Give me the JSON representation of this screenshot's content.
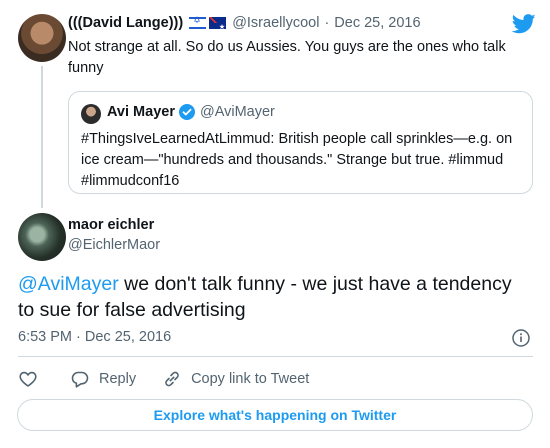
{
  "parent_tweet": {
    "name": "(((David Lange)))",
    "flags": [
      "israel-flag-icon",
      "australia-flag-icon"
    ],
    "handle": "@Israellycool",
    "separator": "·",
    "date": "Dec 25, 2016",
    "text": "Not strange at all. So do us Aussies. You guys are the ones who talk funny"
  },
  "quoted_tweet": {
    "name": "Avi Mayer",
    "verified": true,
    "handle": "@AviMayer",
    "text": "#ThingsIveLearnedAtLimmud: British people call sprinkles—e.g. on ice cream—\"hundreds and thousands.\" Strange but true. #limmud #limmudconf16"
  },
  "main_tweet": {
    "name": "maor eichler",
    "handle": "@EichlerMaor",
    "mention": "@AviMayer",
    "text": " we don't talk funny - we just have a tendency to sue for false advertising",
    "timestamp": "6:53 PM · Dec 25, 2016"
  },
  "actions": {
    "reply_label": "Reply",
    "copy_label": "Copy link to Tweet"
  },
  "explore_button": "Explore what's happening on Twitter",
  "colors": {
    "accent": "#1d9bf0",
    "text": "#0f1419",
    "secondary": "#536471",
    "border": "#cfd9de"
  }
}
